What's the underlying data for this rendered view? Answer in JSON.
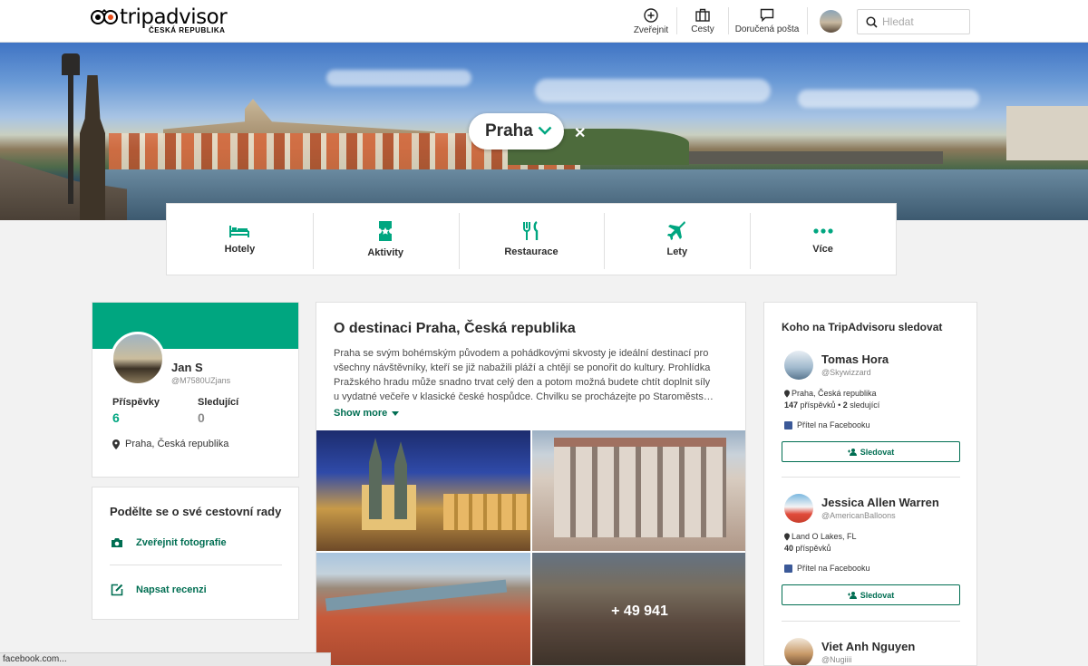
{
  "header": {
    "logo_text": "tripadvisor",
    "logo_sub": "ČESKÁ REPUBLIKA",
    "nav": [
      {
        "label": "Zveřejnit",
        "icon": "plus-circle-icon"
      },
      {
        "label": "Cesty",
        "icon": "suitcase-icon"
      },
      {
        "label": "Doručená pošta",
        "icon": "chat-bubble-icon"
      }
    ],
    "search_placeholder": "Hledat"
  },
  "hero": {
    "destination": "Praha",
    "close_symbol": "✕"
  },
  "categories": [
    {
      "label": "Hotely",
      "icon": "bed-icon"
    },
    {
      "label": "Aktivity",
      "icon": "ticket-icon"
    },
    {
      "label": "Restaurace",
      "icon": "fork-knife-icon"
    },
    {
      "label": "Lety",
      "icon": "plane-icon"
    },
    {
      "label": "Více",
      "icon": "more-dots-icon"
    }
  ],
  "profile": {
    "name": "Jan S",
    "handle": "@M7580UZjans",
    "posts_label": "Příspěvky",
    "posts_value": "6",
    "following_label": "Sledující",
    "following_value": "0",
    "location": "Praha, Česká republika"
  },
  "share": {
    "title": "Podělte se o své cestovní rady",
    "actions": [
      {
        "label": "Zveřejnit fotografie",
        "icon": "camera-icon"
      },
      {
        "label": "Napsat recenzi",
        "icon": "edit-icon"
      }
    ]
  },
  "about": {
    "title": "O destinaci Praha, Česká republika",
    "description": "Praha se svým bohémským původem a pohádkovými skvosty je ideální destinací pro všechny návštěvníky, kteří se již nabažili pláží a chtějí se ponořit do kultury. Prohlídka Pražského hradu může snadno trvat celý den a potom možná budete chtít doplnit síly u vydatné večeře v klasické české hospůdce. Chvilku se procházejte po Staroměsts…",
    "show_more": "Show more",
    "photo_count": "+ 49 941"
  },
  "follow": {
    "title": "Koho na TripAdvisoru sledovat",
    "button_label": "Sledovat",
    "users": [
      {
        "name": "Tomas Hora",
        "handle": "@Skywizzard",
        "location": "Praha, Česká republika",
        "posts": "147",
        "posts_label": "příspěvků",
        "followers": "2",
        "followers_label": "sledující",
        "facebook": "Přítel na Facebooku"
      },
      {
        "name": "Jessica Allen Warren",
        "handle": "@AmericanBalloons",
        "location": "Land O Lakes, FL",
        "posts": "40",
        "posts_label": "příspěvků",
        "facebook": "Přítel na Facebooku"
      },
      {
        "name": "Viet Anh Nguyen",
        "handle": "@Nugiiii"
      }
    ]
  },
  "statusbar": "facebook.com...",
  "colors": {
    "brand_green": "#00a680",
    "link_green": "#006e52"
  }
}
